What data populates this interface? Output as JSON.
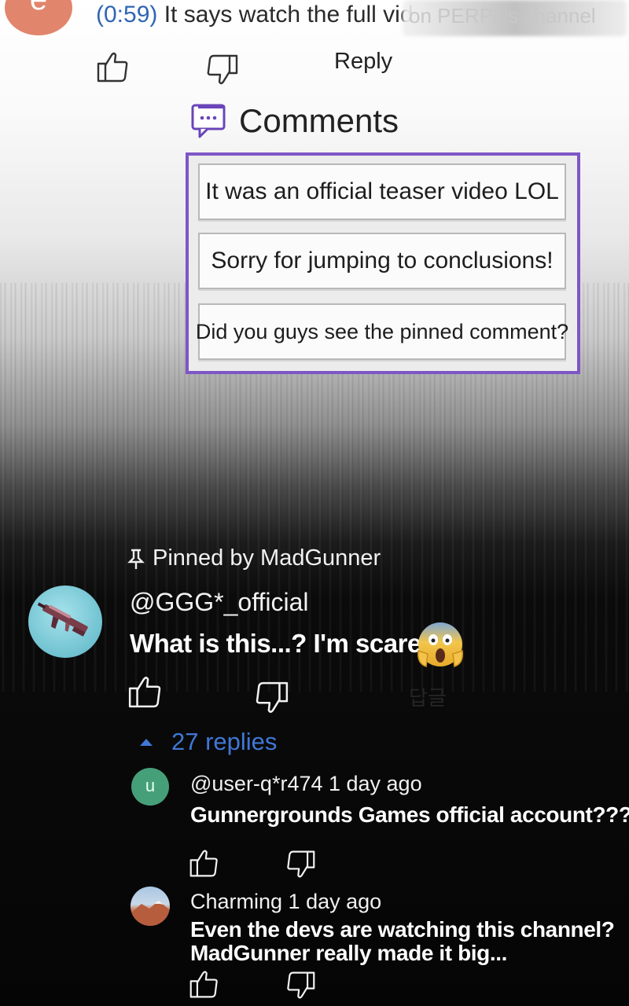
{
  "top_comment": {
    "avatar_letter": "e",
    "timestamp": "(0:59)",
    "text": " It says watch the full vid",
    "blurred_text": "on PERPL's channel",
    "reply_label": "Reply"
  },
  "comments_panel": {
    "title": "Comments",
    "choices": [
      "It was an official teaser video LOL",
      "Sorry for jumping to conclusions!",
      "Did you guys see the pinned comment?"
    ]
  },
  "pinned_comment": {
    "pinned_label": "Pinned by MadGunner",
    "handle": "@GGG*_official",
    "text": "What is this...? I'm scared...",
    "dislike_count_hint": "답글",
    "replies_label": "27 replies"
  },
  "replies": [
    {
      "avatar_letter": "u",
      "meta": "@user-q*r474 1 day ago",
      "body_lines": [
        "Gunnergrounds Games official account???"
      ]
    },
    {
      "meta": "Charming 1 day ago",
      "body_lines": [
        "Even the devs are watching this channel?",
        "MadGunner really made it big..."
      ]
    }
  ],
  "colors": {
    "accent_border": "#7d56c6",
    "timestamp_link": "#2f66b3",
    "replies_link": "#3f78d6"
  }
}
